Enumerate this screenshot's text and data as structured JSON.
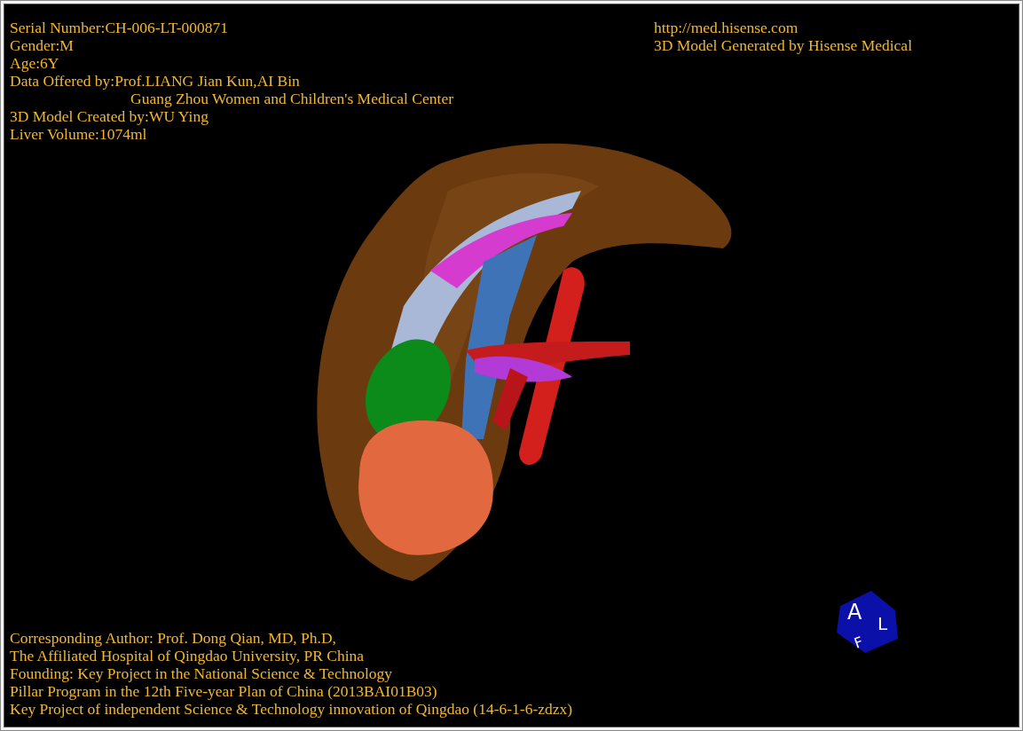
{
  "header_left": [
    {
      "kind": "line",
      "text": "Serial Number:CH-006-LT-000871"
    },
    {
      "kind": "line",
      "text": "Gender:M"
    },
    {
      "kind": "line",
      "text": "Age:6Y"
    },
    {
      "kind": "line",
      "text": "Data Offered by:Prof.LIANG Jian Kun,AI Bin"
    },
    {
      "kind": "continuation",
      "text": "Guang Zhou Women and Children's Medical Center"
    },
    {
      "kind": "line",
      "text": "3D Model Created by:WU Ying"
    },
    {
      "kind": "line",
      "text": "Liver Volume:1074ml"
    }
  ],
  "header_right": [
    "http://med.hisense.com",
    "3D Model Generated by Hisense Medical"
  ],
  "orientation_cube": {
    "faces": [
      "A",
      "L",
      "F"
    ]
  },
  "footer": [
    "Corresponding Author: Prof. Dong Qian, MD, Ph.D,",
    "The Affiliated Hospital of Qingdao University, PR China",
    "Founding: Key Project in the National Science & Technology",
    "Pillar Program in the 12th Five-year Plan of China (2013BAI01B03)",
    "Key Project of independent Science & Technology innovation of Qingdao (14-6-1-6-zdzx)"
  ]
}
